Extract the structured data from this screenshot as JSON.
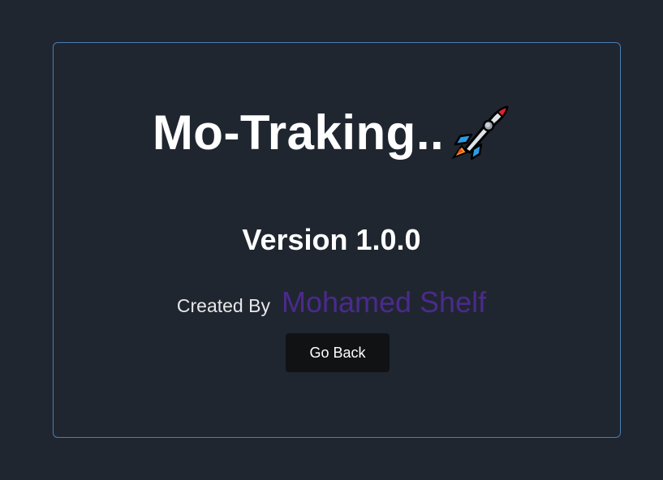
{
  "app": {
    "title": "Mo-Traking..",
    "title_icon": "rocket-icon"
  },
  "info": {
    "version": "Version 1.0.0",
    "created_by_label": "Created By",
    "author": "Mohamed Shelf"
  },
  "actions": {
    "go_back_label": "Go Back"
  },
  "colors": {
    "background": "#1f2630",
    "card_border": "#4a7db3",
    "author_accent": "#4b2a8c",
    "button_bg": "#111214",
    "text": "#ffffff"
  }
}
